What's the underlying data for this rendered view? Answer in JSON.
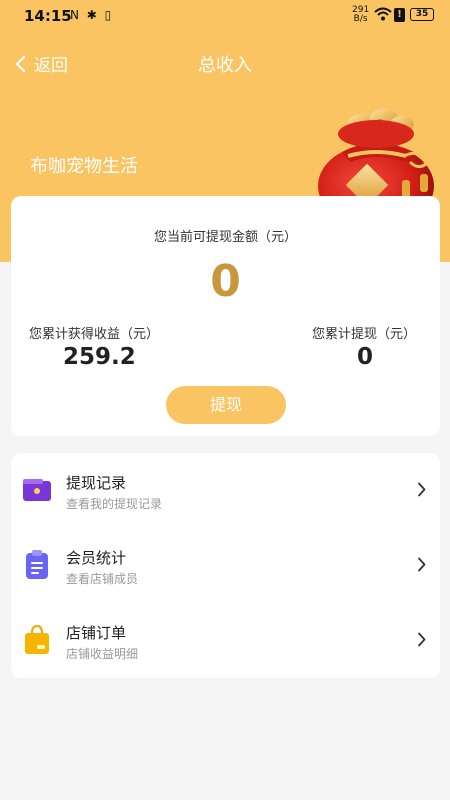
{
  "status_bar": {
    "time": "14:15",
    "left_icons": "N ✱ ▯",
    "speed_value": "291",
    "speed_unit": "B/s",
    "alert": "!",
    "battery": "35"
  },
  "nav": {
    "back_label": "返回",
    "title": "总收入"
  },
  "store_name": "布咖宠物生活",
  "earnings_card": {
    "withdrawable_label": "您当前可提现金额（元）",
    "withdrawable_amount": "0",
    "total_earned_label": "您累计获得收益（元）",
    "total_earned_value": "259.2",
    "total_withdrawn_label": "您累计提现（元）",
    "total_withdrawn_value": "0",
    "withdraw_button": "提现"
  },
  "menu": {
    "items": [
      {
        "title": "提现记录",
        "subtitle": "查看我的提现记录",
        "icon": "wallet-icon"
      },
      {
        "title": "会员统计",
        "subtitle": "查看店铺成员",
        "icon": "clipboard-icon"
      },
      {
        "title": "店铺订单",
        "subtitle": "店铺收益明细",
        "icon": "shopping-bag-icon"
      }
    ]
  },
  "colors": {
    "brand": "#fbc462",
    "amount": "#c9973b",
    "pouch_red": "#e0281f"
  }
}
